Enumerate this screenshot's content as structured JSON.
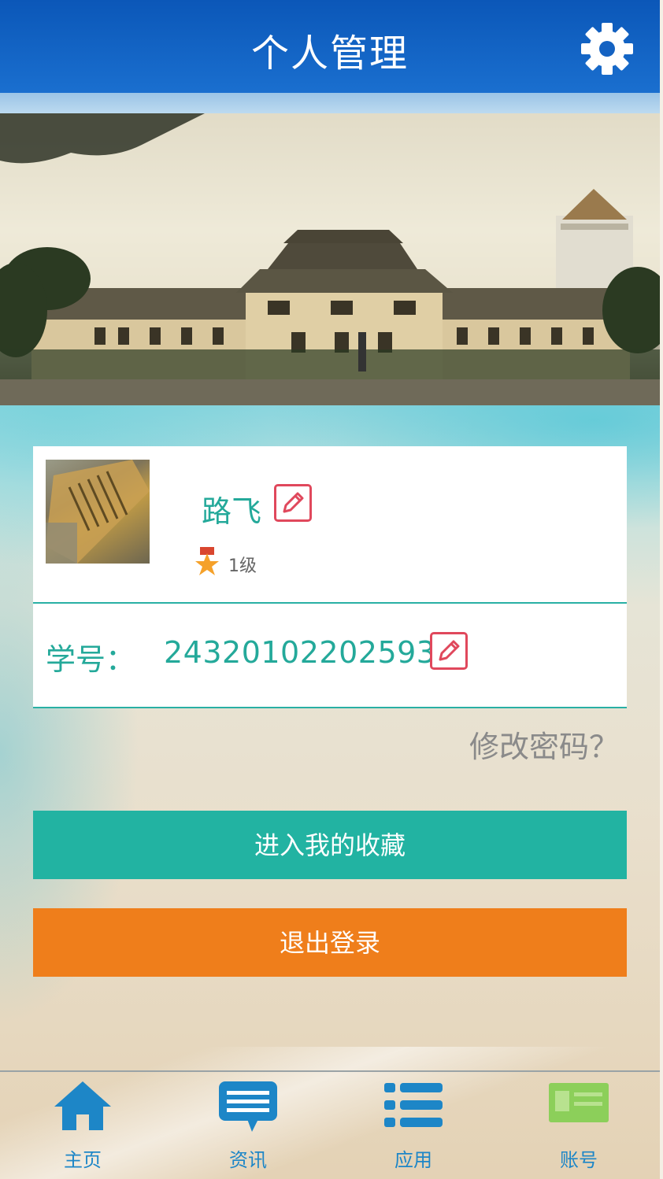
{
  "header": {
    "title": "个人管理",
    "settings_icon": "gear-icon"
  },
  "banner": {
    "image": "campus-building-photo"
  },
  "profile": {
    "username": "路飞",
    "level": "1级",
    "student_id_label": "学号：",
    "student_id": "24320102202593"
  },
  "links": {
    "change_password": "修改密码？"
  },
  "buttons": {
    "favorites": "进入我的收藏",
    "logout": "退出登录"
  },
  "tabbar": {
    "items": [
      {
        "label": "主页",
        "icon": "home-icon"
      },
      {
        "label": "资讯",
        "icon": "chat-icon"
      },
      {
        "label": "应用",
        "icon": "list-icon"
      },
      {
        "label": "账号",
        "icon": "account-icon"
      }
    ]
  },
  "colors": {
    "header": "#0b57b8",
    "accent_teal": "#22b3a2",
    "logout_orange": "#ef7e1b",
    "edit_red": "#e0485c",
    "tab_blue": "#1d86c7",
    "tab_active_green": "#8ccf5a"
  }
}
